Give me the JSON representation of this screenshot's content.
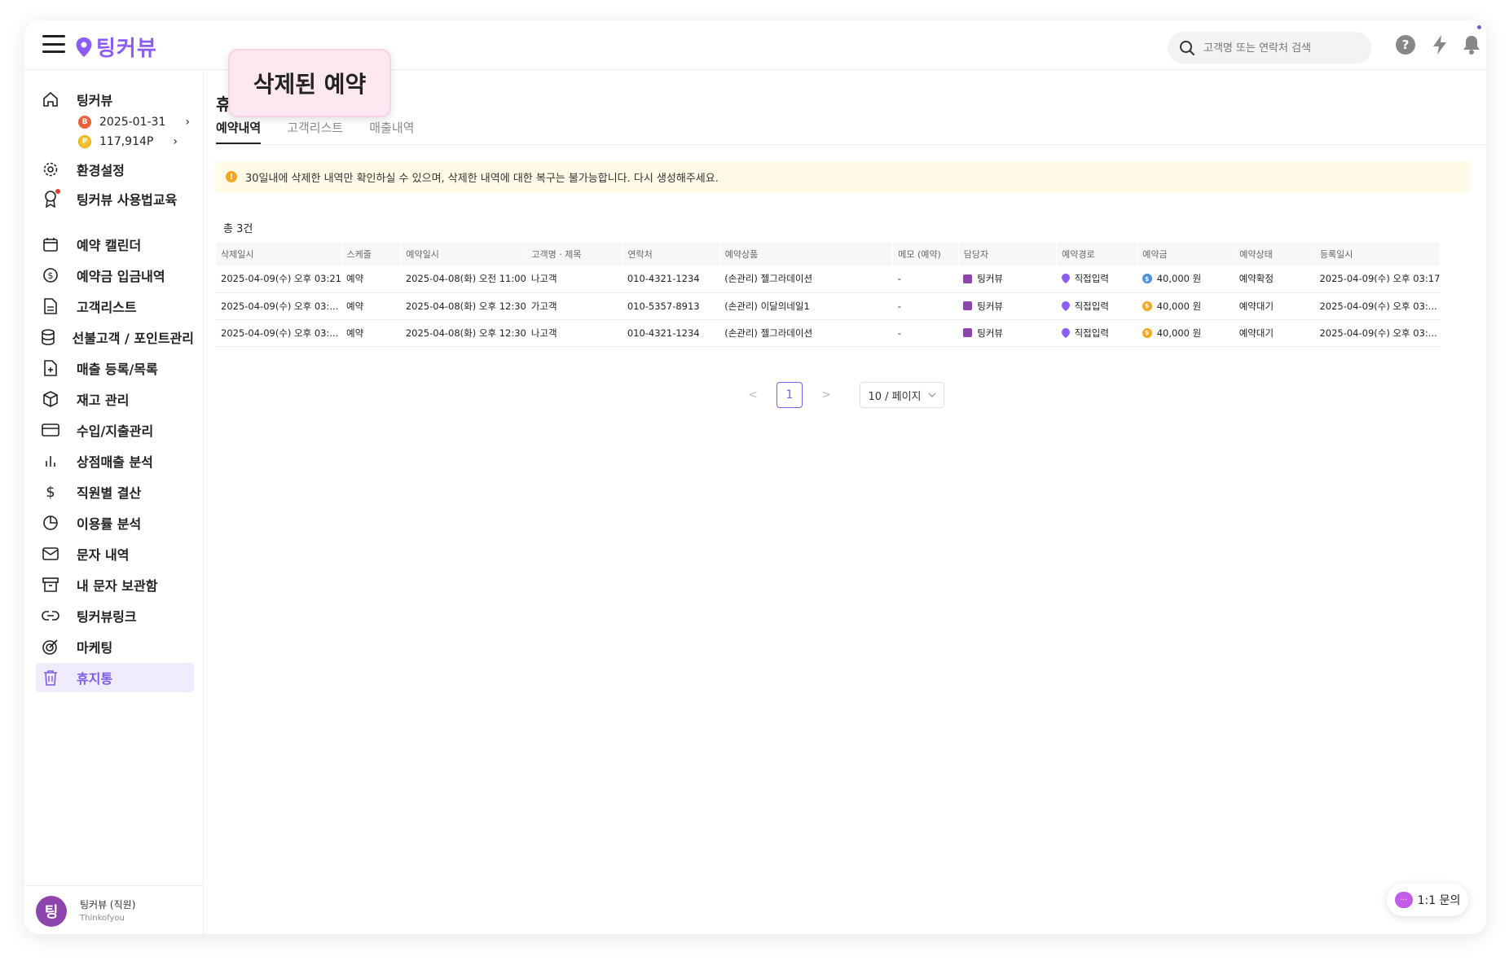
{
  "app": {
    "logo_text": "팅커뷰",
    "search_placeholder": "고객명 또는 연락처 검색"
  },
  "sidebar": {
    "home_label": "팅커뷰",
    "expiry_date": "2025-01-31",
    "points": "117,914P",
    "badge_b": "B",
    "badge_p": "P",
    "items": [
      {
        "label": "환경설정"
      },
      {
        "label": "팅커뷰 사용법교육"
      },
      {
        "label": "예약 캘린더"
      },
      {
        "label": "예약금 입금내역"
      },
      {
        "label": "고객리스트"
      },
      {
        "label": "선불고객 / 포인트관리"
      },
      {
        "label": "매출 등록/목록"
      },
      {
        "label": "재고 관리"
      },
      {
        "label": "수입/지출관리"
      },
      {
        "label": "상점매출 분석"
      },
      {
        "label": "직원별 결산"
      },
      {
        "label": "이용률 분석"
      },
      {
        "label": "문자 내역"
      },
      {
        "label": "내 문자 보관함"
      },
      {
        "label": "팅커뷰링크"
      },
      {
        "label": "마케팅"
      },
      {
        "label": "휴지통"
      }
    ],
    "user": {
      "avatar_letter": "팅",
      "name": "팅커뷰 (직원)",
      "sub": "Thinkofyou"
    }
  },
  "main": {
    "page_title": "휴",
    "tooltip": "삭제된 예약",
    "tabs": [
      {
        "label": "예약내역"
      },
      {
        "label": "고객리스트"
      },
      {
        "label": "매출내역"
      }
    ],
    "notice": "30일내에 삭제한 내역만 확인하실 수 있으며, 삭제한 내역에 대한 복구는 불가능합니다. 다시 생성해주세요.",
    "warn_symbol": "!",
    "total": "총 3건",
    "table": {
      "headers": [
        "삭제일시",
        "스케줄",
        "예약일시",
        "고객명 · 제목",
        "연락처",
        "예약상품",
        "메모 (예약)",
        "담당자",
        "예약경로",
        "예약금",
        "예약상태",
        "등록일시"
      ],
      "rows": [
        {
          "deleted": "2025-04-09(수) 오후 03:21",
          "schedule": "예약",
          "reserved": "2025-04-08(화) 오전 11:00",
          "customer": "나고객",
          "phone": "010-4321-1234",
          "product": "(손관리) 젤그라데이션",
          "memo": "-",
          "staff": "팅커뷰",
          "route": "직접입력",
          "deposit": "40,000 원",
          "deposit_coin": "$",
          "deposit_color": "#4a90e2",
          "status": "예약확정",
          "registered": "2025-04-09(수) 오후 03:17"
        },
        {
          "deleted": "2025-04-09(수) 오후 03:...",
          "schedule": "예약",
          "reserved": "2025-04-08(화) 오후 12:30",
          "customer": "가고객",
          "phone": "010-5357-8913",
          "product": "(손관리) 이달의네일1",
          "memo": "-",
          "staff": "팅커뷰",
          "route": "직접입력",
          "deposit": "40,000 원",
          "deposit_coin": "$",
          "deposit_color": "#f5a623",
          "status": "예약대기",
          "registered": "2025-04-09(수) 오후 03:..."
        },
        {
          "deleted": "2025-04-09(수) 오후 03:...",
          "schedule": "예약",
          "reserved": "2025-04-08(화) 오후 12:30",
          "customer": "나고객",
          "phone": "010-4321-1234",
          "product": "(손관리) 젤그라데이션",
          "memo": "-",
          "staff": "팅커뷰",
          "route": "직접입력",
          "deposit": "40,000 원",
          "deposit_coin": "$",
          "deposit_color": "#f5a623",
          "status": "예약대기",
          "registered": "2025-04-09(수) 오후 03:..."
        }
      ]
    },
    "pagination": {
      "prev": "<",
      "current": "1",
      "next": ">",
      "page_size": "10 / 페이지"
    },
    "inquiry": {
      "label": "1:1 문의",
      "bubble": "···"
    }
  },
  "colors": {
    "accent": "#7c5ce8",
    "logo": "#8b5cf6",
    "notice_bg": "#fffbe6",
    "tooltip_bg": "#fde7f1"
  }
}
